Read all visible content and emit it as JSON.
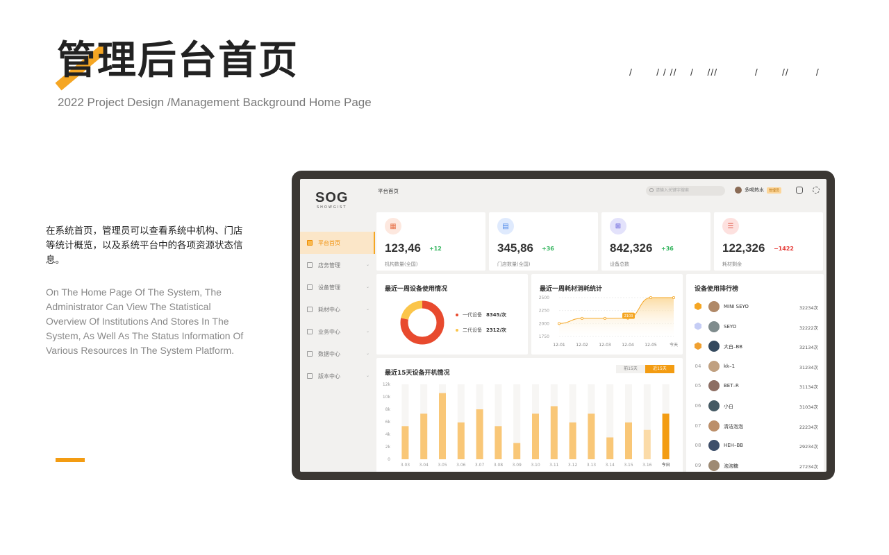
{
  "hero": {
    "title": "管理后台首页",
    "subtitle": "2022 Project Design /Management Background Home Page",
    "slashes": "/       / / //    /    ///           /       //        /",
    "desc_cn": "在系统首页，管理员可以查看系统中机构、门店等统计概览，以及系统平台中的各项资源状态信息。",
    "desc_en": "On The Home Page Of The System, The Administrator Can View The Statistical Overview Of Institutions And Stores In The System, As Well As The Status Information Of Various Resources In The System Platform."
  },
  "app": {
    "logo": "SOG",
    "logo_sub": "SHOWGIST",
    "breadcrumb": "平台首页",
    "search_placeholder": "请输入关键字搜索",
    "user_name": "多喝热水",
    "user_role": "管理员",
    "nav": [
      {
        "label": "平台首页",
        "active": true
      },
      {
        "label": "店务管理"
      },
      {
        "label": "设备管理"
      },
      {
        "label": "耗材中心"
      },
      {
        "label": "业务中心"
      },
      {
        "label": "数据中心"
      },
      {
        "label": "版本中心"
      }
    ],
    "chevron": "⌄",
    "stats": [
      {
        "value": "123,46",
        "delta": "+12",
        "label": "机构数量(全国)",
        "icon": "building-icon",
        "bg": "#fde8df",
        "fg": "#e8734a",
        "up": true
      },
      {
        "value": "345,86",
        "delta": "+36",
        "label": "门店数量(全国)",
        "icon": "store-icon",
        "bg": "#dfeafd",
        "fg": "#4a86e8",
        "up": true
      },
      {
        "value": "842,326",
        "delta": "+36",
        "label": "设备总数",
        "icon": "device-icon",
        "bg": "#e3e2fb",
        "fg": "#5b55d8",
        "up": true
      },
      {
        "value": "122,326",
        "delta": "−1422",
        "label": "耗材剩余",
        "icon": "clipboard-icon",
        "bg": "#fde1df",
        "fg": "#e05a4a",
        "up": false
      }
    ],
    "colors": {
      "up": "#2fb35a",
      "down": "#e53935",
      "accent": "#f5a623"
    }
  },
  "chart_data": [
    {
      "type": "pie",
      "title": "最近一周设备使用情况",
      "series": [
        {
          "name": "一代设备",
          "value": 8345,
          "unit": "次",
          "color": "#e84a2e"
        },
        {
          "name": "二代设备",
          "value": 2312,
          "unit": "次",
          "color": "#fbc54a"
        }
      ]
    },
    {
      "type": "area",
      "title": "最近一周耗材消耗统计",
      "x": [
        "12-01",
        "12-02",
        "12-03",
        "12-04",
        "12-05",
        "今天"
      ],
      "values": [
        2000,
        2100,
        2100,
        2103,
        2500,
        2500
      ],
      "ylim": [
        1750,
        2500
      ],
      "yticks": [
        1750,
        2000,
        2250,
        2500
      ],
      "highlight": {
        "x": "12-04",
        "label": "2103"
      },
      "color": "#f5a623"
    },
    {
      "type": "bar",
      "title": "最近15天设备开机情况",
      "toggle": [
        "前15天",
        "近15天"
      ],
      "categories": [
        "3.03",
        "3.04",
        "3.05",
        "3.06",
        "3.07",
        "3.08",
        "3.09",
        "3.10",
        "3.11",
        "3.12",
        "3.13",
        "3.14",
        "3.15",
        "3.16",
        "今日"
      ],
      "values": [
        5300,
        7300,
        10600,
        5900,
        8000,
        5300,
        2600,
        7300,
        8500,
        5900,
        7300,
        3500,
        5900,
        4700,
        7300
      ],
      "ylim": [
        0,
        12000
      ],
      "yticks": [
        "0",
        "2k",
        "4k",
        "6k",
        "8k",
        "10k",
        "12k"
      ],
      "colors": {
        "bar": "#f9c777",
        "faded": "#fbdba8",
        "today": "#f39c12",
        "track": "#f7f6f4"
      }
    }
  ],
  "ranking": {
    "title": "设备使用排行榜",
    "items": [
      {
        "rank": "01",
        "name": "MINI SEYO",
        "value": "32234次",
        "badge": "#f5a623",
        "av": "#b08968"
      },
      {
        "rank": "02",
        "name": "SEYO",
        "value": "32222次",
        "badge": "#c5cdf5",
        "av": "#7f8c8d"
      },
      {
        "rank": "03",
        "name": "大白–BB",
        "value": "32134次",
        "badge": "#f0a030",
        "av": "#34495e"
      },
      {
        "rank": "04",
        "name": "kk–1",
        "value": "31234次",
        "av": "#c0a080"
      },
      {
        "rank": "05",
        "name": "BET–R",
        "value": "31134次",
        "av": "#8d6e63"
      },
      {
        "rank": "06",
        "name": "小白",
        "value": "31034次",
        "av": "#455a64"
      },
      {
        "rank": "07",
        "name": "清洁泡泡",
        "value": "22234次",
        "av": "#bc8f6a"
      },
      {
        "rank": "08",
        "name": "HEH–BB",
        "value": "29234次",
        "av": "#3e4f6a"
      },
      {
        "rank": "09",
        "name": "泡泡糖",
        "value": "27234次",
        "av": "#9e8a73"
      }
    ]
  }
}
